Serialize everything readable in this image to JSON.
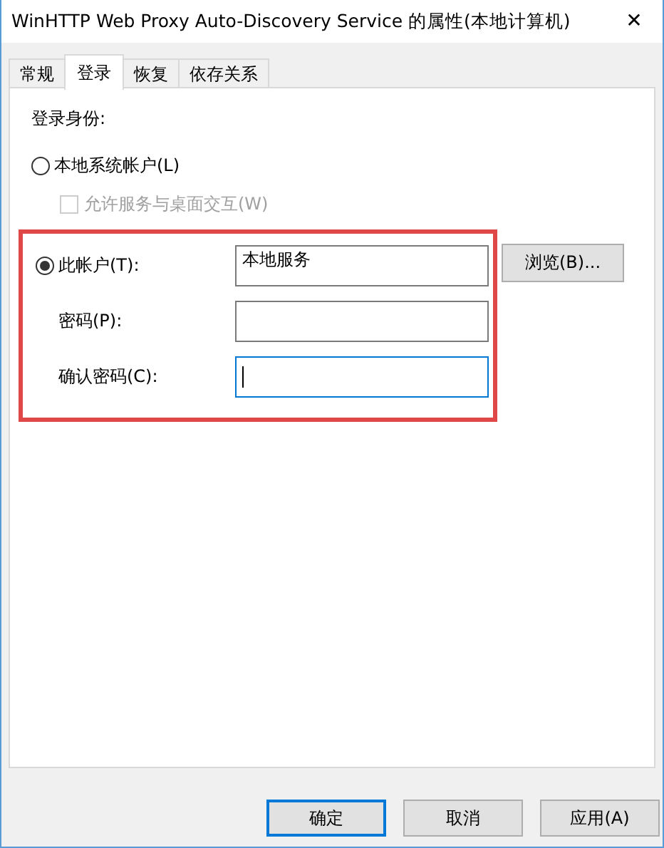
{
  "window": {
    "title": "WinHTTP Web Proxy Auto-Discovery Service 的属性(本地计算机)",
    "close": "✕"
  },
  "tabs": [
    {
      "label": "常规",
      "selected": false
    },
    {
      "label": "登录",
      "selected": true
    },
    {
      "label": "恢复",
      "selected": false
    },
    {
      "label": "依存关系",
      "selected": false
    }
  ],
  "logon_heading": "登录身份:",
  "local_system": {
    "label": "本地系统帐户(L)",
    "selected": false
  },
  "interact_checkbox": {
    "label": "允许服务与桌面交互(W)",
    "checked": false,
    "disabled": true
  },
  "this_account": {
    "label": "此帐户(T):",
    "selected": true,
    "value": "本地服务",
    "browse": "浏览(B)..."
  },
  "password": {
    "label": "密码(P):"
  },
  "confirm_password": {
    "label": "确认密码(C):",
    "focused": true
  },
  "buttons": [
    "确定",
    "取消",
    "应用(A)"
  ]
}
